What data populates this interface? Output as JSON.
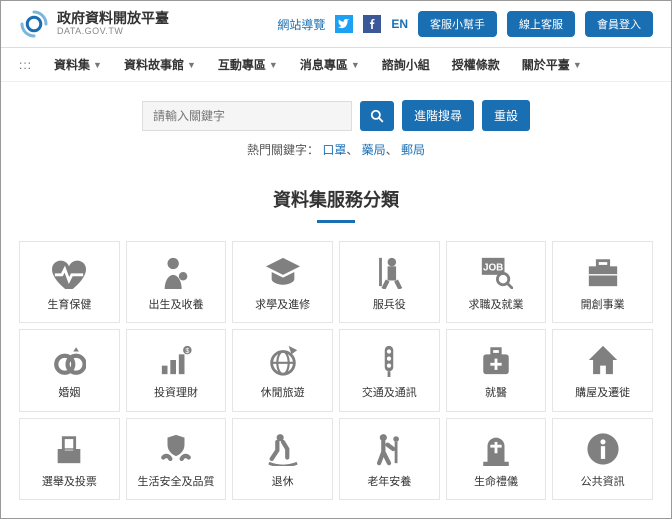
{
  "header": {
    "site_title": "政府資料開放平臺",
    "site_subtitle": "DATA.GOV.TW",
    "sitemap_label": "網站導覽",
    "lang_label": "EN",
    "buttons": [
      "客服小幫手",
      "線上客服",
      "會員登入"
    ]
  },
  "nav": {
    "items": [
      {
        "label": "資料集",
        "dropdown": true
      },
      {
        "label": "資料故事館",
        "dropdown": true
      },
      {
        "label": "互動專區",
        "dropdown": true
      },
      {
        "label": "消息專區",
        "dropdown": true
      },
      {
        "label": "諮詢小組",
        "dropdown": false
      },
      {
        "label": "授權條款",
        "dropdown": false
      },
      {
        "label": "關於平臺",
        "dropdown": true
      }
    ]
  },
  "search": {
    "placeholder": "請輸入關鍵字",
    "advanced_label": "進階搜尋",
    "reset_label": "重設",
    "hot_label": "熱門關鍵字：",
    "hot_keywords": [
      "口罩",
      "藥局",
      "郵局"
    ]
  },
  "section": {
    "title": "資料集服務分類"
  },
  "categories": [
    {
      "icon": "heart-pulse-icon",
      "label": "生育保健"
    },
    {
      "icon": "mother-child-icon",
      "label": "出生及收養"
    },
    {
      "icon": "graduation-icon",
      "label": "求學及進修"
    },
    {
      "icon": "soldier-icon",
      "label": "服兵役"
    },
    {
      "icon": "job-search-icon",
      "label": "求職及就業"
    },
    {
      "icon": "briefcase-icon",
      "label": "開創事業"
    },
    {
      "icon": "rings-icon",
      "label": "婚姻"
    },
    {
      "icon": "chart-money-icon",
      "label": "投資理財"
    },
    {
      "icon": "globe-plane-icon",
      "label": "休閒旅遊"
    },
    {
      "icon": "traffic-light-icon",
      "label": "交通及通訊"
    },
    {
      "icon": "medical-kit-icon",
      "label": "就醫"
    },
    {
      "icon": "house-icon",
      "label": "購屋及遷徙"
    },
    {
      "icon": "ballot-icon",
      "label": "選舉及投票"
    },
    {
      "icon": "hands-shield-icon",
      "label": "生活安全及品質"
    },
    {
      "icon": "rocking-chair-icon",
      "label": "退休"
    },
    {
      "icon": "elderly-icon",
      "label": "老年安養"
    },
    {
      "icon": "tombstone-icon",
      "label": "生命禮儀"
    },
    {
      "icon": "info-icon",
      "label": "公共資訊"
    }
  ]
}
